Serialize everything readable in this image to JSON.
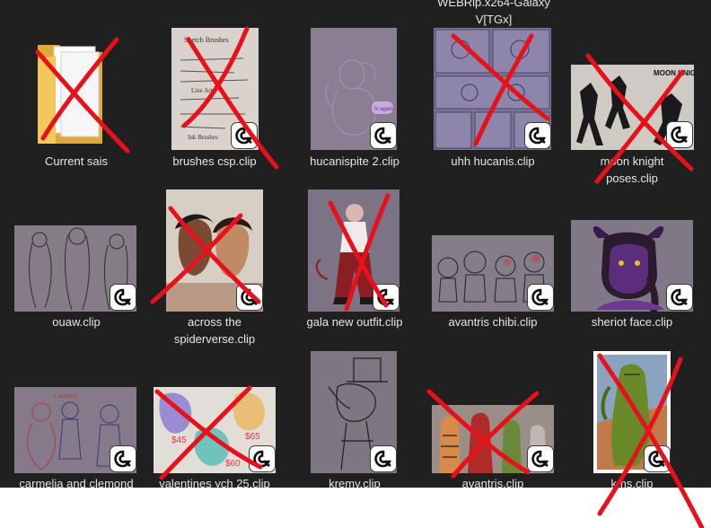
{
  "partial_label": {
    "line1": "WEBRip.x264-Galaxy",
    "line2": "V[TGx]"
  },
  "files": [
    {
      "name": "Current sais",
      "type": "folder"
    },
    {
      "name": "brushes csp.clip",
      "type": "clip"
    },
    {
      "name": "hucanispite 2.clip",
      "type": "clip"
    },
    {
      "name": "uhh hucanis.clip",
      "type": "clip"
    },
    {
      "name_line1": "moon knight",
      "name_line2": "poses.clip",
      "type": "clip"
    },
    {
      "name": "ouaw.clip",
      "type": "clip"
    },
    {
      "name_line1": "across the",
      "name_line2": "spiderverse.clip",
      "type": "clip"
    },
    {
      "name": "gala new outfit.clip",
      "type": "clip"
    },
    {
      "name": "avantris chibi.clip",
      "type": "clip"
    },
    {
      "name": "sheriot face.clip",
      "type": "clip"
    },
    {
      "name": "carmelia and clemond",
      "type": "clip"
    },
    {
      "name": "valentines ych 25.clip",
      "type": "clip"
    },
    {
      "name": "kremy.clip",
      "type": "clip"
    },
    {
      "name": "avantris.clip",
      "type": "clip"
    },
    {
      "name": "kms.clip",
      "type": "clip"
    }
  ],
  "thumbnail_text": {
    "brushes_notes": [
      "Sketch Brushes",
      "Line Art",
      "Ink Brushes"
    ],
    "hucanispite_sticker": "hi again",
    "moon_knight_heading": "MOON KNIGHT",
    "carmelia_heading": "Carmelia",
    "valentines_prices": [
      "$45",
      "$65",
      "$60"
    ]
  },
  "colors": {
    "background": "#202020",
    "label_text": "#e6e6e6",
    "strike": "#e8101a",
    "folder": "#f3c75a"
  },
  "icons": {
    "folder": "folder-icon",
    "clip_badge": "clip-studio-badge-icon"
  }
}
